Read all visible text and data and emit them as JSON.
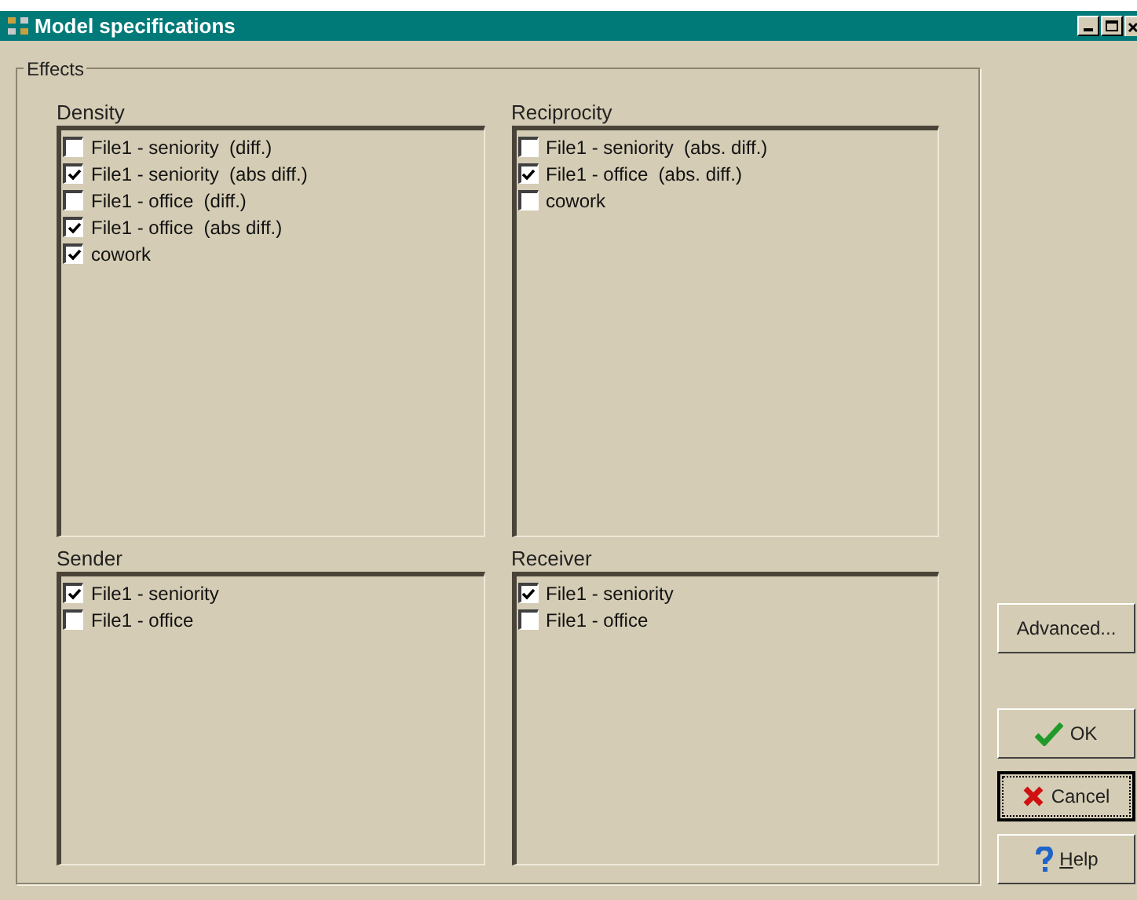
{
  "window": {
    "title": "Model specifications"
  },
  "effects": {
    "label": "Effects",
    "panels": [
      {
        "title": "Density",
        "items": [
          {
            "label": "File1 - seniority  (diff.)",
            "checked": false
          },
          {
            "label": "File1 - seniority  (abs diff.)",
            "checked": true
          },
          {
            "label": "File1 - office  (diff.)",
            "checked": false
          },
          {
            "label": "File1 - office  (abs diff.)",
            "checked": true
          },
          {
            "label": "cowork",
            "checked": true
          }
        ]
      },
      {
        "title": "Reciprocity",
        "items": [
          {
            "label": "File1 - seniority  (abs. diff.)",
            "checked": false
          },
          {
            "label": "File1 - office  (abs. diff.)",
            "checked": true
          },
          {
            "label": "cowork",
            "checked": false
          }
        ]
      },
      {
        "title": "Sender",
        "items": [
          {
            "label": "File1 - seniority",
            "checked": true
          },
          {
            "label": "File1 - office",
            "checked": false
          }
        ]
      },
      {
        "title": "Receiver",
        "items": [
          {
            "label": "File1 - seniority",
            "checked": true
          },
          {
            "label": "File1 - office",
            "checked": false
          }
        ]
      }
    ]
  },
  "buttons": [
    {
      "label": "Advanced...",
      "kind": "plain",
      "focused": false,
      "underline_first": false
    },
    {
      "label": "OK",
      "kind": "ok",
      "focused": false,
      "underline_first": false
    },
    {
      "label": "Cancel",
      "kind": "cancel",
      "focused": true,
      "underline_first": false
    },
    {
      "label": "Help",
      "kind": "help",
      "focused": false,
      "underline_first": true
    }
  ]
}
